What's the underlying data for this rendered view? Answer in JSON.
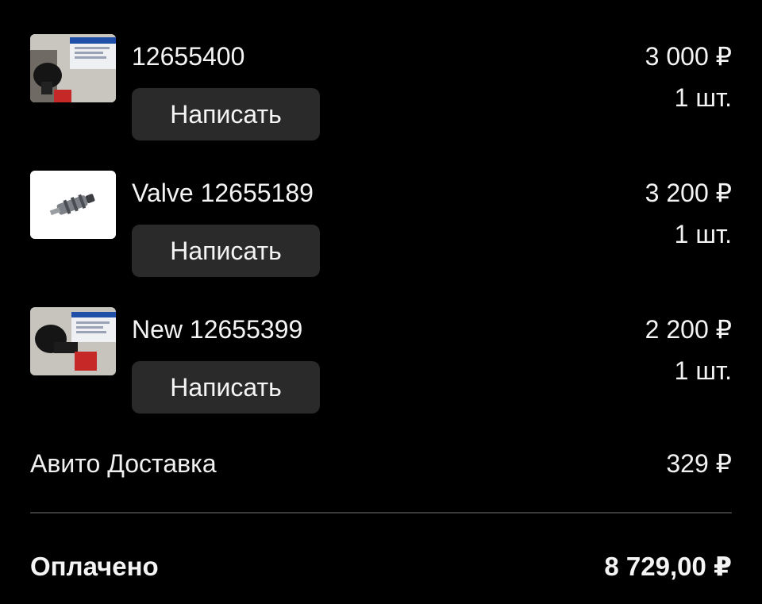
{
  "items": [
    {
      "title": "12655400",
      "price": "3 000 ₽",
      "quantity": "1 шт.",
      "button_label": "Написать",
      "thumbnail": "part-photo-connector-with-box"
    },
    {
      "title": "Valve 12655189",
      "price": "3 200 ₽",
      "quantity": "1 шт.",
      "button_label": "Написать",
      "thumbnail": "part-photo-valve-white-background"
    },
    {
      "title": "New 12655399",
      "price": "2 200 ₽",
      "quantity": "1 шт.",
      "button_label": "Написать",
      "thumbnail": "part-photo-connector-with-box"
    }
  ],
  "delivery": {
    "label": "Авито Доставка",
    "price": "329 ₽"
  },
  "total": {
    "label": "Оплачено",
    "value": "8 729,00 ₽"
  },
  "colors": {
    "background": "#000000",
    "text": "#f4f4f4",
    "button_background": "#2a2a2a",
    "divider": "#3a3a3a"
  }
}
